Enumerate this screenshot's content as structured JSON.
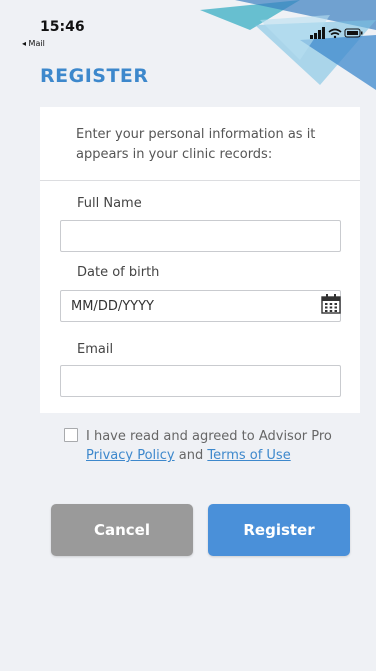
{
  "status_bar": {
    "time": "15:46",
    "back_app": "◂ Mail",
    "icons": [
      "signal-icon",
      "wifi-icon",
      "battery-icon"
    ]
  },
  "page": {
    "title": "REGISTER"
  },
  "form": {
    "intro": "Enter your personal information as it appears in your clinic records:",
    "full_name": {
      "label": "Full Name",
      "value": "",
      "placeholder": ""
    },
    "dob": {
      "label": "Date of birth",
      "value": "",
      "placeholder": "MM/DD/YYYY"
    },
    "email": {
      "label": "Email",
      "value": "",
      "placeholder": ""
    }
  },
  "agreement": {
    "checked": false,
    "text_prefix": "I have read and agreed to Advisor Pro",
    "privacy_link": "Privacy Policy",
    "conjunction": " and ",
    "terms_link": "Terms of Use"
  },
  "buttons": {
    "cancel": "Cancel",
    "register": "Register"
  },
  "colors": {
    "accent": "#3d88cc",
    "register_button": "#4a90d9",
    "cancel_button": "#9a9a9a",
    "background": "#eff1f5"
  }
}
